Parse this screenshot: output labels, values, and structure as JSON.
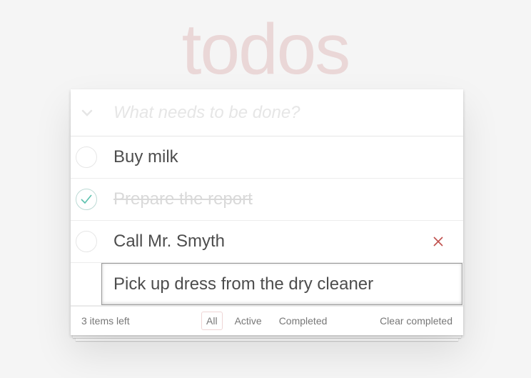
{
  "app": {
    "title": "todos"
  },
  "new_todo": {
    "placeholder": "What needs to be done?",
    "value": ""
  },
  "todos": [
    {
      "label": "Buy milk",
      "completed": false
    },
    {
      "label": "Prepare the report",
      "completed": true
    },
    {
      "label": "Call Mr. Smyth",
      "completed": false,
      "hovered": true
    },
    {
      "label": "Pick up dress from the dry cleaner",
      "completed": false,
      "editing": true
    }
  ],
  "footer": {
    "count_text": "3 items left",
    "filters": [
      "All",
      "Active",
      "Completed"
    ],
    "selected_filter": "All",
    "clear_completed": "Clear completed"
  },
  "colors": {
    "title": "#efd5d5",
    "check": "#5dc2af",
    "destroy": "#cc9a9a",
    "accent_border": "#e7c8c8"
  },
  "icons": {
    "toggle_all": "chevron-down-icon",
    "check": "checkmark-icon",
    "destroy": "close-icon"
  }
}
